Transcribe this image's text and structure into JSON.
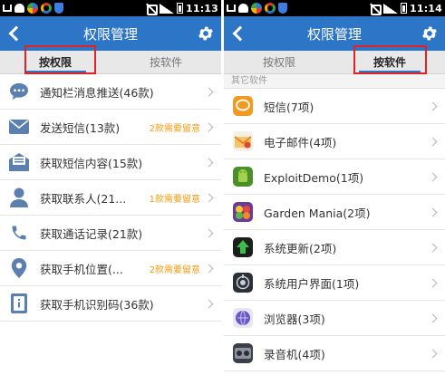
{
  "status_bar": {
    "left": {
      "time": "11:13"
    },
    "right": {
      "time": "11:14"
    }
  },
  "left_screen": {
    "title": "权限管理",
    "tabs": [
      {
        "label": "按权限",
        "active": true
      },
      {
        "label": "按软件",
        "active": false
      }
    ],
    "items": [
      {
        "label": "通知栏消息推送(46款)",
        "note": "",
        "icon": "chat-bubble-icon"
      },
      {
        "label": "发送短信(13款)",
        "note": "2款需要留意",
        "icon": "envelope-icon"
      },
      {
        "label": "获取短信内容(15款)",
        "note": "",
        "icon": "open-envelope-icon"
      },
      {
        "label": "获取联系人(21...",
        "note": "1款需要留意",
        "icon": "person-icon"
      },
      {
        "label": "获取通话记录(21款)",
        "note": "",
        "icon": "phone-icon"
      },
      {
        "label": "获取手机位置(...",
        "note": "2款需要留意",
        "icon": "location-pin-icon"
      },
      {
        "label": "获取手机识别码(36款)",
        "note": "",
        "icon": "id-card-icon"
      }
    ]
  },
  "right_screen": {
    "title": "权限管理",
    "tabs": [
      {
        "label": "按权限",
        "active": false
      },
      {
        "label": "按软件",
        "active": true
      }
    ],
    "section_header": "其它软件",
    "apps": [
      {
        "label": "短信(7项)",
        "icon": "sms-app-icon"
      },
      {
        "label": "电子邮件(4项)",
        "icon": "email-app-icon"
      },
      {
        "label": "ExploitDemo(1项)",
        "icon": "android-app-icon"
      },
      {
        "label": "Garden Mania(2项)",
        "icon": "garden-mania-app-icon"
      },
      {
        "label": "系统更新(2项)",
        "icon": "system-update-app-icon"
      },
      {
        "label": "系统用户界面(1项)",
        "icon": "system-ui-app-icon"
      },
      {
        "label": "浏览器(3项)",
        "icon": "browser-app-icon"
      },
      {
        "label": "录音机(4项)",
        "icon": "recorder-app-icon"
      }
    ]
  },
  "colors": {
    "title_bar": "#2d75c6",
    "note_orange": "#f39c12",
    "highlight_box": "#e02222",
    "tab_bar": "#e8e8e8"
  }
}
